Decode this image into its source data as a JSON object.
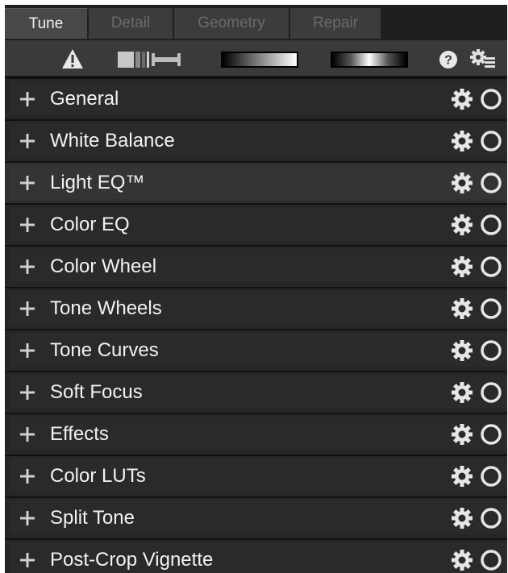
{
  "tabs": [
    "Tune",
    "Detail",
    "Geometry",
    "Repair"
  ],
  "active_tab": "Tune",
  "toolbar": {
    "icons": [
      "warning-icon",
      "tone-preview-icon",
      "luminance-gradient",
      "midtone-gradient",
      "help-icon",
      "panel-settings-icon"
    ],
    "help_glyph": "?"
  },
  "panels": [
    {
      "label": "General"
    },
    {
      "label": "White Balance"
    },
    {
      "label": "Light EQ™"
    },
    {
      "label": "Color EQ"
    },
    {
      "label": "Color Wheel"
    },
    {
      "label": "Tone Wheels"
    },
    {
      "label": "Tone Curves"
    },
    {
      "label": "Soft Focus"
    },
    {
      "label": "Effects"
    },
    {
      "label": "Color LUTs"
    },
    {
      "label": "Split Tone"
    },
    {
      "label": "Post-Crop Vignette"
    }
  ],
  "highlighted_panel": "Light EQ™",
  "colors": {
    "background": "#1f1f1f",
    "row": "#2a2a2a",
    "text": "#f2f2f2",
    "inactive_tab_text": "#6a6a6a"
  }
}
